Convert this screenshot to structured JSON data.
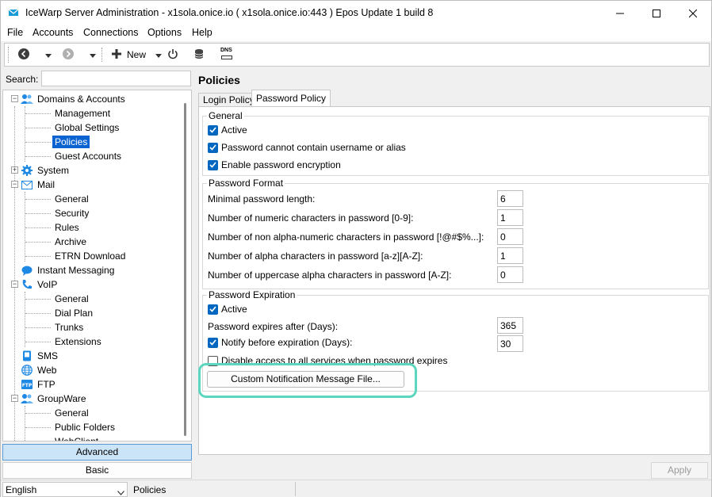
{
  "window": {
    "title": "IceWarp Server Administration - x1sola.onice.io ( x1sola.onice.io:443 ) Epos Update 1 build 8"
  },
  "menu": [
    "File",
    "Accounts",
    "Connections",
    "Options",
    "Help"
  ],
  "toolbar": {
    "new_label": "New",
    "dns_label": "DNS"
  },
  "left": {
    "search_label": "Search:",
    "search_value": "",
    "tree": [
      {
        "label": "Domains & Accounts",
        "icon": "users-icon"
      },
      {
        "label": "Management"
      },
      {
        "label": "Global Settings"
      },
      {
        "label": "Policies",
        "selected": true
      },
      {
        "label": "Guest Accounts"
      },
      {
        "label": "System",
        "icon": "gear-icon"
      },
      {
        "label": "Mail",
        "icon": "envelope-icon"
      },
      {
        "label": "General"
      },
      {
        "label": "Security"
      },
      {
        "label": "Rules"
      },
      {
        "label": "Archive"
      },
      {
        "label": "ETRN Download"
      },
      {
        "label": "Instant Messaging",
        "icon": "chat-bubble-icon"
      },
      {
        "label": "VoIP",
        "icon": "phone-icon"
      },
      {
        "label": "General"
      },
      {
        "label": "Dial Plan"
      },
      {
        "label": "Trunks"
      },
      {
        "label": "Extensions"
      },
      {
        "label": "SMS",
        "icon": "sms-icon"
      },
      {
        "label": "Web",
        "icon": "globe-icon"
      },
      {
        "label": "FTP",
        "icon": "ftp-icon"
      },
      {
        "label": "GroupWare",
        "icon": "group-icon"
      },
      {
        "label": "General"
      },
      {
        "label": "Public Folders"
      },
      {
        "label": "WebClient"
      }
    ],
    "advanced_label": "Advanced",
    "basic_label": "Basic"
  },
  "main": {
    "page_title": "Policies",
    "tabs": [
      {
        "label": "Login Policy",
        "active": false
      },
      {
        "label": "Password Policy",
        "active": true
      }
    ],
    "general": {
      "title": "General",
      "active_label": "Active",
      "active_checked": true,
      "no_username_label": "Password cannot contain username or alias",
      "no_username_checked": true,
      "encryption_label": "Enable password encryption",
      "encryption_checked": true
    },
    "format": {
      "title": "Password Format",
      "fields": [
        {
          "label": "Minimal password length:",
          "value": "6"
        },
        {
          "label": "Number of numeric characters in password [0-9]:",
          "value": "1"
        },
        {
          "label": "Number of non alpha-numeric characters in password [!@#$%...]:",
          "value": "0"
        },
        {
          "label": "Number of alpha characters in password [a-z][A-Z]:",
          "value": "1"
        },
        {
          "label": "Number of uppercase alpha characters in password [A-Z]:",
          "value": "0"
        }
      ]
    },
    "expiration": {
      "title": "Password Expiration",
      "active_label": "Active",
      "active_checked": true,
      "expires_label": "Password expires after (Days):",
      "expires_value": "365",
      "notify_label": "Notify before expiration (Days):",
      "notify_checked": true,
      "notify_value": "30",
      "disable_label": "Disable access to all services when password expires",
      "disable_checked": false,
      "custom_button_label": "Custom Notification Message File..."
    },
    "apply_label": "Apply"
  },
  "status": {
    "language": "English",
    "section": "Policies"
  },
  "colors": {
    "selection": "#0a63d0",
    "checkbox": "#0067c0",
    "highlight": "#5cd6bf"
  }
}
